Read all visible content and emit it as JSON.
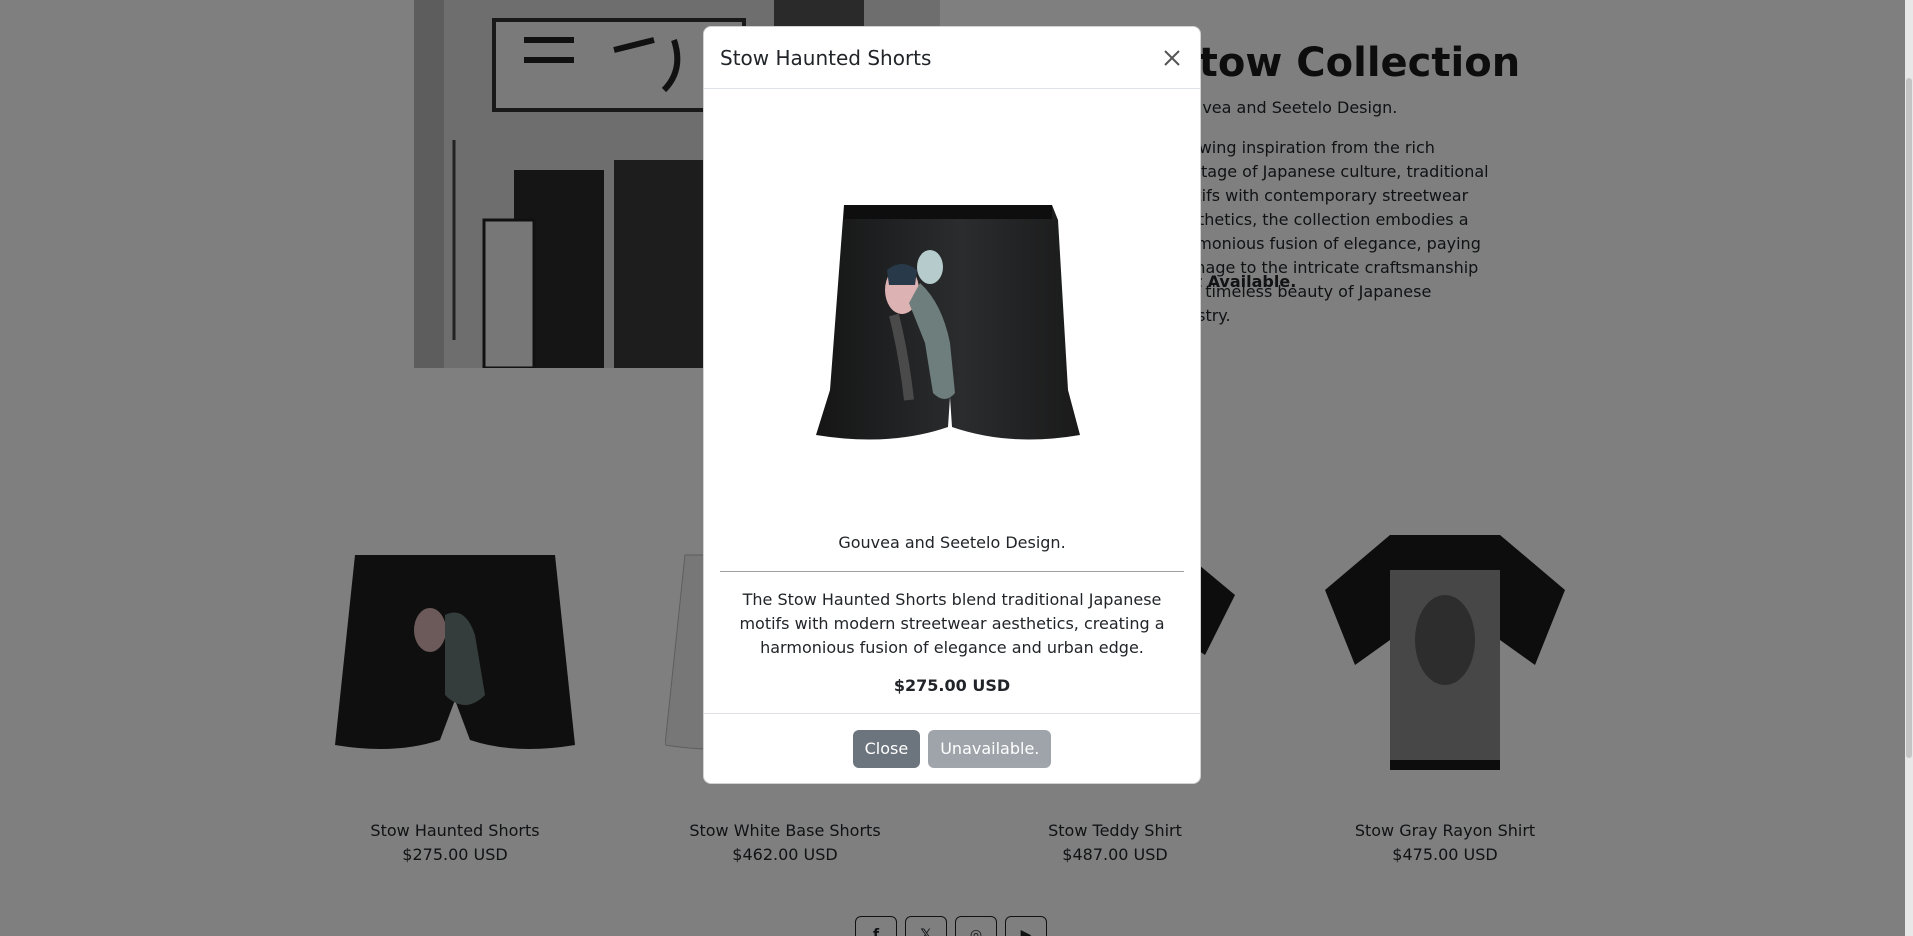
{
  "hero": {
    "title": "Stow Collection",
    "subtitle": "Gouvea and Seetelo Design.",
    "description": "Drawing inspiration from the rich heritage of Japanese culture, traditional motifs with contemporary streetwear aesthetics, the collection embodies a harmonious fusion of elegance, paying homage to the intricate craftsmanship and timeless beauty of Japanese artistry.",
    "availability": "Not Available."
  },
  "products": [
    {
      "name": "Stow Haunted Shorts",
      "price": "$275.00 USD"
    },
    {
      "name": "Stow White Base Shorts",
      "price": "$462.00 USD"
    },
    {
      "name": "Stow Teddy Shirt",
      "price": "$487.00 USD"
    },
    {
      "name": "Stow Gray Rayon Shirt",
      "price": "$475.00 USD"
    }
  ],
  "socials": [
    "facebook-icon",
    "x-icon",
    "instagram-icon",
    "youtube-icon"
  ],
  "modal": {
    "title": "Stow Haunted Shorts",
    "designer": "Gouvea and Seetelo Design.",
    "description": "The Stow Haunted Shorts blend traditional Japanese motifs with modern streetwear aesthetics, creating a harmonious fusion of elegance and urban edge.",
    "price": "$275.00 USD",
    "close_label": "Close",
    "unavailable_label": "Unavailable."
  },
  "colors": {
    "backdrop": "rgba(0,0,0,0.5)",
    "button": "#6c757d"
  }
}
